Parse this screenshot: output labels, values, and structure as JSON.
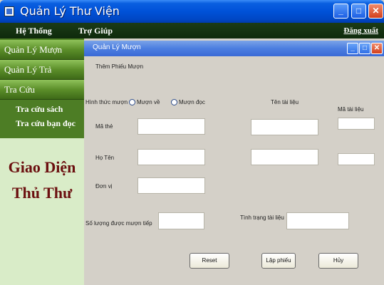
{
  "window": {
    "title": "Quản Lý Thư Viện"
  },
  "menu": {
    "items": [
      "Hệ Thống",
      "Trợ Giúp"
    ],
    "logout": "Đăng xuất"
  },
  "sidebar": {
    "buttons": [
      "Quản Lý Mượn",
      "Quản Lý Trả",
      "Tra Cứu"
    ],
    "sub_items": [
      "Tra cứu sách",
      "Tra cứu bạn đọc"
    ],
    "big_text": [
      "Giao Diện",
      "Thủ Thư"
    ]
  },
  "inner": {
    "title": "Quản Lý Mượn",
    "section": "Thêm Phiếu Mượn",
    "form": {
      "borrow_type_label": "Hình thức mượn",
      "radio_take_home": "Mượn về",
      "radio_read_in": "Mượn đọc",
      "card_id_label": "Mã thẻ",
      "full_name_label": "Họ Tên",
      "unit_label": "Đơn vị",
      "quantity_label": "Số lượng được mượn tiếp",
      "doc_name_label": "Tên tài liệu",
      "doc_id_label": "Mã tài liệu",
      "doc_status_label": "Tình trạng tài liệu"
    },
    "buttons": {
      "reset": "Reset",
      "create": "Lập phiếu",
      "cancel": "Hủy"
    }
  }
}
